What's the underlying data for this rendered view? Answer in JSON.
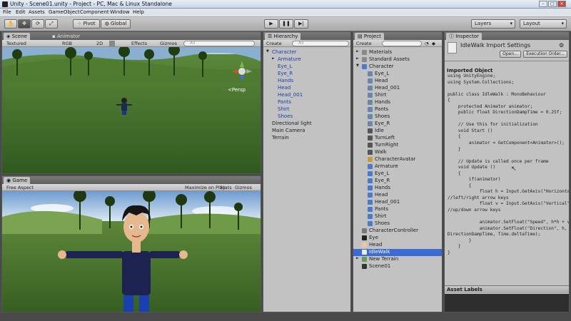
{
  "window": {
    "title": "Unity - Scene01.unity - Project - PC, Mac & Linux Standalone"
  },
  "menu": [
    "File",
    "Edit",
    "Assets",
    "GameObject",
    "Component",
    "Window",
    "Help"
  ],
  "toolbar": {
    "pivot": "Pivot",
    "global": "Global",
    "layers": "Layers",
    "layout": "Layout",
    "play_icon": "play-icon",
    "pause_icon": "pause-icon",
    "step_icon": "step-icon"
  },
  "scene": {
    "tabs": [
      "Scene",
      "Animator"
    ],
    "bar": [
      "Textured",
      "RGB",
      "2D",
      "Effects",
      "Gizmos",
      "All"
    ],
    "persp": "<Persp"
  },
  "game": {
    "tab": "Game",
    "bar": [
      "Free Aspect",
      "Maximize on Play",
      "Stats",
      "Gizmos"
    ]
  },
  "hierarchy": {
    "tab": "Hierarchy",
    "create": "Create",
    "search": "All",
    "items": [
      {
        "label": "Character",
        "indent": 0,
        "arrow": "▼",
        "blue": true
      },
      {
        "label": "Armature",
        "indent": 1,
        "arrow": "►",
        "blue": true
      },
      {
        "label": "Eye_L",
        "indent": 1,
        "arrow": "",
        "blue": true
      },
      {
        "label": "Eye_R",
        "indent": 1,
        "arrow": "",
        "blue": true
      },
      {
        "label": "Hands",
        "indent": 1,
        "arrow": "",
        "blue": true
      },
      {
        "label": "Head",
        "indent": 1,
        "arrow": "",
        "blue": true
      },
      {
        "label": "Head_001",
        "indent": 1,
        "arrow": "",
        "blue": true
      },
      {
        "label": "Pants",
        "indent": 1,
        "arrow": "",
        "blue": true
      },
      {
        "label": "Shirt",
        "indent": 1,
        "arrow": "",
        "blue": true
      },
      {
        "label": "Shoes",
        "indent": 1,
        "arrow": "",
        "blue": true
      },
      {
        "label": "Directional light",
        "indent": 0,
        "arrow": "",
        "blue": false
      },
      {
        "label": "Main Camera",
        "indent": 0,
        "arrow": "",
        "blue": false
      },
      {
        "label": "Terrain",
        "indent": 0,
        "arrow": "",
        "blue": false
      }
    ]
  },
  "project": {
    "tab": "Project",
    "create": "Create",
    "items": [
      {
        "label": "Materials",
        "indent": 0,
        "arrow": "►",
        "icon": "folder-icon",
        "color": "#8a8a8a"
      },
      {
        "label": "Standard Assets",
        "indent": 0,
        "arrow": "►",
        "icon": "folder-icon",
        "color": "#8a8a8a"
      },
      {
        "label": "Character",
        "indent": 0,
        "arrow": "▼",
        "icon": "model-icon",
        "color": "#4a7ac8"
      },
      {
        "label": "Eye_L",
        "indent": 1,
        "arrow": "",
        "icon": "mesh-icon",
        "color": "#6a86a8"
      },
      {
        "label": "Head",
        "indent": 1,
        "arrow": "",
        "icon": "mesh-icon",
        "color": "#6a86a8"
      },
      {
        "label": "Head_001",
        "indent": 1,
        "arrow": "",
        "icon": "mesh-icon",
        "color": "#6a86a8"
      },
      {
        "label": "Shirt",
        "indent": 1,
        "arrow": "",
        "icon": "mesh-icon",
        "color": "#6a86a8"
      },
      {
        "label": "Hands",
        "indent": 1,
        "arrow": "",
        "icon": "mesh-icon",
        "color": "#6a86a8"
      },
      {
        "label": "Pants",
        "indent": 1,
        "arrow": "",
        "icon": "mesh-icon",
        "color": "#6a86a8"
      },
      {
        "label": "Shoes",
        "indent": 1,
        "arrow": "",
        "icon": "mesh-icon",
        "color": "#6a86a8"
      },
      {
        "label": "Eye_R",
        "indent": 1,
        "arrow": "",
        "icon": "mesh-icon",
        "color": "#6a86a8"
      },
      {
        "label": "Idle",
        "indent": 1,
        "arrow": "",
        "icon": "anim-icon",
        "color": "#555"
      },
      {
        "label": "TurnLeft",
        "indent": 1,
        "arrow": "",
        "icon": "anim-icon",
        "color": "#555"
      },
      {
        "label": "TurnRight",
        "indent": 1,
        "arrow": "",
        "icon": "anim-icon",
        "color": "#555"
      },
      {
        "label": "Walk",
        "indent": 1,
        "arrow": "",
        "icon": "anim-icon",
        "color": "#555"
      },
      {
        "label": "CharacterAvatar",
        "indent": 1,
        "arrow": "",
        "icon": "avatar-icon",
        "color": "#c89a3a"
      },
      {
        "label": "Armature",
        "indent": 1,
        "arrow": "",
        "icon": "model-icon",
        "color": "#4a7ac8"
      },
      {
        "label": "Eye_L",
        "indent": 1,
        "arrow": "",
        "icon": "model-icon",
        "color": "#4a7ac8"
      },
      {
        "label": "Eye_R",
        "indent": 1,
        "arrow": "",
        "icon": "model-icon",
        "color": "#4a7ac8"
      },
      {
        "label": "Hands",
        "indent": 1,
        "arrow": "",
        "icon": "model-icon",
        "color": "#4a7ac8"
      },
      {
        "label": "Head",
        "indent": 1,
        "arrow": "",
        "icon": "model-icon",
        "color": "#4a7ac8"
      },
      {
        "label": "Head_001",
        "indent": 1,
        "arrow": "",
        "icon": "model-icon",
        "color": "#4a7ac8"
      },
      {
        "label": "Pants",
        "indent": 1,
        "arrow": "",
        "icon": "model-icon",
        "color": "#4a7ac8"
      },
      {
        "label": "Shirt",
        "indent": 1,
        "arrow": "",
        "icon": "model-icon",
        "color": "#4a7ac8"
      },
      {
        "label": "Shoes",
        "indent": 1,
        "arrow": "",
        "icon": "model-icon",
        "color": "#4a7ac8"
      },
      {
        "label": "CharacterController",
        "indent": 0,
        "arrow": "",
        "icon": "controller-icon",
        "color": "#777"
      },
      {
        "label": "Eye",
        "indent": 0,
        "arrow": "",
        "icon": "material-icon",
        "color": "#222"
      },
      {
        "label": "Head",
        "indent": 0,
        "arrow": "",
        "icon": "material-icon",
        "color": "#e8c8a0"
      },
      {
        "label": "IdleWalk",
        "indent": 0,
        "arrow": "",
        "icon": "script-icon",
        "color": "#eaeaea",
        "selected": true
      },
      {
        "label": "New Terrain",
        "indent": 0,
        "arrow": "►",
        "icon": "terrain-icon",
        "color": "#6a9a5a"
      },
      {
        "label": "Scene01",
        "indent": 0,
        "arrow": "",
        "icon": "unity-scene-icon",
        "color": "#333"
      }
    ]
  },
  "inspector": {
    "tab": "Inspector",
    "title": "IdleWalk Import Settings",
    "open": "Open...",
    "exec": "Execution Order...",
    "section": "Imported Object",
    "code": "using UnityEngine;\nusing System.Collections;\n\npublic class IdleWalk : MonoBehaviour\n{\n    protected Animator animator;\n    public float DirectionDampTime = 0.25f;\n\n    // Use this for initialization\n    void Start ()\n    {\n        animator = GetComponent<Animator>();\n    }\n\n    // Update is called once per frame\n    void Update ()\n    {\n        if(animator)\n        {\n            float h = Input.GetAxis(\"Horizontal\");\n//left/right arrow keys\n            float v = Input.GetAxis(\"Vertical\");\n//up/down arrow keys\n\n            animator.SetFloat(\"Speed\", h*h + v*v);\n            animator.SetFloat(\"Direction\", h,\nDirectionDampTime, Time.deltaTime);\n        }\n    }\n}",
    "asset_labels": "Asset Labels"
  }
}
